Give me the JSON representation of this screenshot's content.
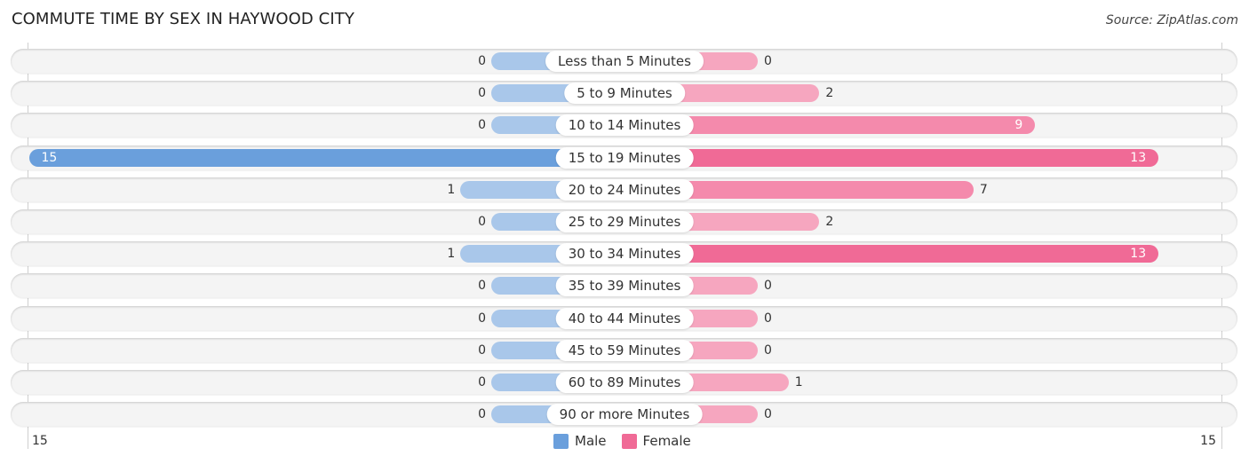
{
  "title": "COMMUTE TIME BY SEX IN HAYWOOD CITY",
  "source": "Source: ZipAtlas.com",
  "colors": {
    "male": "#6a9fdc",
    "female": "#f06a96"
  },
  "chart_data": {
    "type": "bar",
    "orientation": "horizontal-diverging",
    "title": "COMMUTE TIME BY SEX IN HAYWOOD CITY",
    "categories": [
      "Less than 5 Minutes",
      "5 to 9 Minutes",
      "10 to 14 Minutes",
      "15 to 19 Minutes",
      "20 to 24 Minutes",
      "25 to 29 Minutes",
      "30 to 34 Minutes",
      "35 to 39 Minutes",
      "40 to 44 Minutes",
      "45 to 59 Minutes",
      "60 to 89 Minutes",
      "90 or more Minutes"
    ],
    "series": [
      {
        "name": "Male",
        "values": [
          0,
          0,
          0,
          15,
          1,
          0,
          1,
          0,
          0,
          0,
          0,
          0
        ]
      },
      {
        "name": "Female",
        "values": [
          0,
          2,
          9,
          13,
          7,
          2,
          13,
          0,
          0,
          0,
          1,
          0
        ]
      }
    ],
    "xlim": [
      -15,
      15
    ],
    "axis_ticks": {
      "left": "15",
      "right": "15"
    },
    "legend": {
      "entries": [
        "Male",
        "Female"
      ],
      "position": "bottom-center"
    },
    "grid": false
  }
}
